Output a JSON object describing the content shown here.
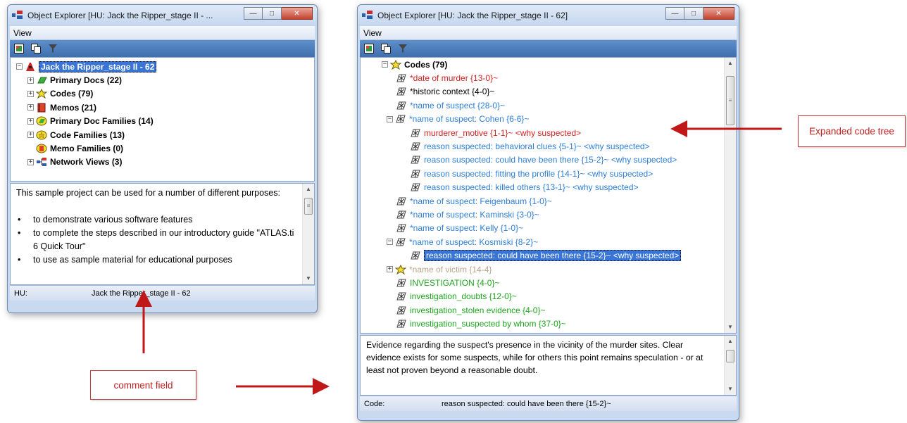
{
  "left_window": {
    "title": "Object Explorer  [HU: Jack the Ripper_stage II - ...",
    "menu": "View",
    "tree": {
      "root": "Jack the Ripper_stage II - 62",
      "items": [
        {
          "label": "Primary Docs (22)",
          "icon": "primary-docs-icon"
        },
        {
          "label": "Codes (79)",
          "icon": "codes-icon"
        },
        {
          "label": "Memos (21)",
          "icon": "memos-icon"
        },
        {
          "label": "Primary Doc Families (14)",
          "icon": "pd-families-icon"
        },
        {
          "label": "Code Families (13)",
          "icon": "code-families-icon"
        },
        {
          "label": "Memo Families (0)",
          "icon": "memo-families-icon"
        },
        {
          "label": "Network Views (3)",
          "icon": "network-views-icon"
        }
      ]
    },
    "comment": {
      "intro": "This sample project can be used for a number of different purposes:",
      "bullets": [
        "to demonstrate various software features",
        "to complete the steps described in our introductory guide \"ATLAS.ti 6 Quick Tour\"",
        "to use as sample material for educational purposes"
      ]
    },
    "status": {
      "label": "HU:",
      "value": "Jack the Ripper_stage II - 62"
    }
  },
  "right_window": {
    "title": "Object Explorer  [HU: Jack the Ripper_stage II - 62]",
    "menu": "View",
    "codes_header": "Codes (79)",
    "codes": [
      {
        "label": "*date of murder {13-0}~",
        "color": "red",
        "level": 1
      },
      {
        "label": "*historic context {4-0}~",
        "color": "black",
        "level": 1
      },
      {
        "label": "*name of suspect {28-0}~",
        "color": "blue",
        "level": 1
      },
      {
        "label": "*name of suspect: Cohen {6-6}~",
        "color": "blue",
        "level": 1,
        "expanded": true
      },
      {
        "label": "murderer_motive {1-1}~ <why suspected>",
        "color": "red",
        "level": 2
      },
      {
        "label": "reason suspected: behavioral clues {5-1}~ <why suspected>",
        "color": "blue",
        "level": 2
      },
      {
        "label": "reason suspected: could have been there {15-2}~ <why suspected>",
        "color": "blue",
        "level": 2
      },
      {
        "label": "reason suspected: fitting the profile {14-1}~ <why suspected>",
        "color": "blue",
        "level": 2
      },
      {
        "label": "reason suspected: killed others {13-1}~ <why suspected>",
        "color": "blue",
        "level": 2
      },
      {
        "label": "*name of suspect: Feigenbaum {1-0}~",
        "color": "blue",
        "level": 1
      },
      {
        "label": "*name of suspect: Kaminski {3-0}~",
        "color": "blue",
        "level": 1
      },
      {
        "label": "*name of suspect: Kelly {1-0}~",
        "color": "blue",
        "level": 1
      },
      {
        "label": "*name of suspect: Kosmiski {8-2}~",
        "color": "blue",
        "level": 1,
        "expanded": true
      },
      {
        "label": "reason suspected: could have been there {15-2}~ <why suspected>",
        "color": "selected",
        "level": 2
      },
      {
        "label": "*name of victim {14-4}",
        "color": "grey",
        "level": 1,
        "collapsed": true
      },
      {
        "label": "INVESTIGATION {4-0}~",
        "color": "green",
        "level": 1
      },
      {
        "label": "investigation_doubts {12-0}~",
        "color": "green",
        "level": 1
      },
      {
        "label": "investigation_stolen evidence {4-0}~",
        "color": "green",
        "level": 1
      },
      {
        "label": "investigation_suspected by whom {37-0}~",
        "color": "green",
        "level": 1
      }
    ],
    "comment": "Evidence regarding the suspect's presence in the vicinity of the murder sites. Clear evidence exists for some suspects, while for others this point remains speculation - or at least not proven beyond a reasonable doubt.",
    "status": {
      "label": "Code:",
      "value": "reason suspected: could have been there {15-2}~"
    }
  },
  "annotations": {
    "expanded": "Expanded code tree",
    "comment": "comment field"
  },
  "colors": {
    "red": "#d42020",
    "blue": "#2e7ed6",
    "green": "#1fa51f",
    "grey": "#b9a58a",
    "arrow": "#c01818"
  }
}
